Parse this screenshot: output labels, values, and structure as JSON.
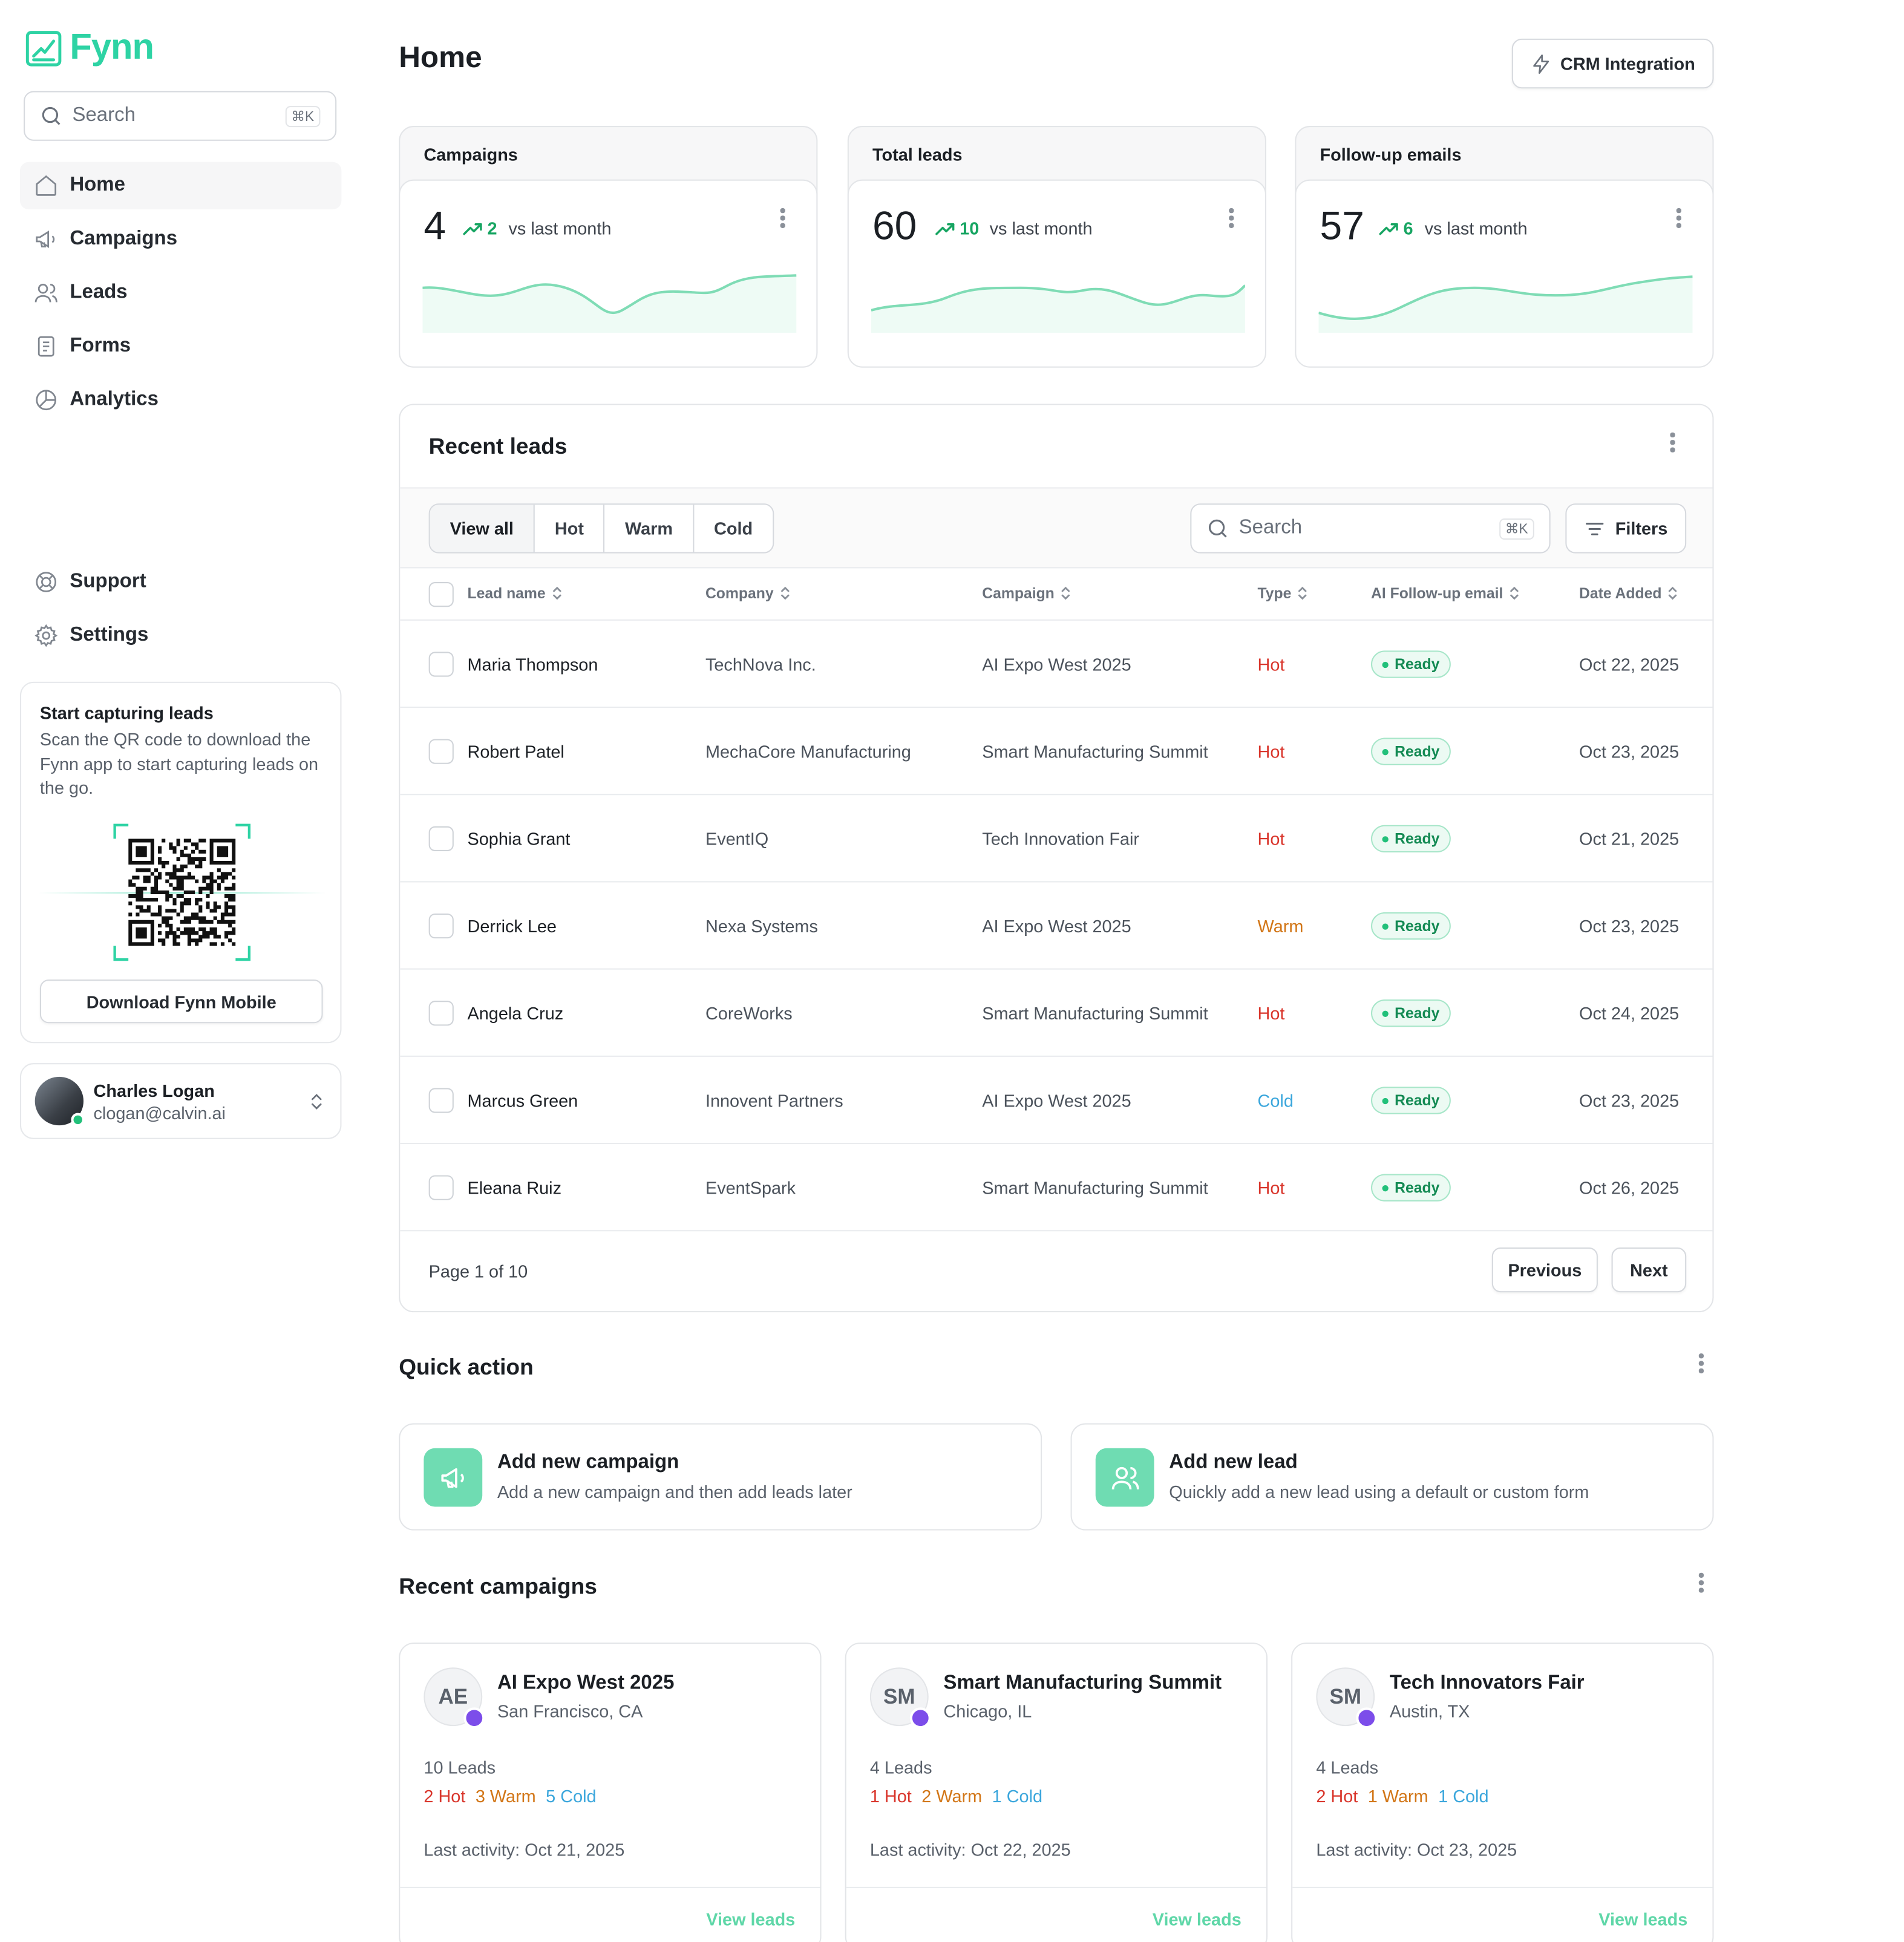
{
  "app": {
    "brand": "Fynn",
    "accent": "#2ed3a4"
  },
  "sidebar": {
    "search": {
      "placeholder": "Search",
      "shortcut": "⌘K"
    },
    "items": [
      {
        "label": "Home",
        "icon": "home-icon",
        "active": true
      },
      {
        "label": "Campaigns",
        "icon": "megaphone-icon"
      },
      {
        "label": "Leads",
        "icon": "users-icon"
      },
      {
        "label": "Forms",
        "icon": "form-icon"
      },
      {
        "label": "Analytics",
        "icon": "pie-chart-icon"
      }
    ],
    "bottom_items": [
      {
        "label": "Support",
        "icon": "lifebuoy-icon"
      },
      {
        "label": "Settings",
        "icon": "gear-icon"
      }
    ],
    "promo": {
      "title": "Start capturing leads",
      "text": "Scan the QR code to download the Fynn app to start capturing leads on the go.",
      "button": "Download Fynn Mobile"
    },
    "user": {
      "name": "Charles Logan",
      "email": "clogan@calvin.ai",
      "online": true
    }
  },
  "header": {
    "title": "Home",
    "crm_button": "CRM Integration"
  },
  "stats": [
    {
      "title": "Campaigns",
      "value": "4",
      "delta": "2",
      "vs": "vs last month"
    },
    {
      "title": "Total leads",
      "value": "60",
      "delta": "10",
      "vs": "vs last month"
    },
    {
      "title": "Follow-up emails",
      "value": "57",
      "delta": "6",
      "vs": "vs last month"
    }
  ],
  "recent_leads": {
    "title": "Recent leads",
    "filters": [
      "View all",
      "Hot",
      "Warm",
      "Cold"
    ],
    "active_filter": "View all",
    "search": {
      "placeholder": "Search",
      "shortcut": "⌘K"
    },
    "filters_button": "Filters",
    "columns": [
      "Lead name",
      "Company",
      "Campaign",
      "Type",
      "AI Follow-up email",
      "Date Added"
    ],
    "rows": [
      {
        "name": "Maria Thompson",
        "company": "TechNova Inc.",
        "campaign": "AI Expo West 2025",
        "type": "Hot",
        "email": "Ready",
        "date": "Oct 22, 2025"
      },
      {
        "name": "Robert Patel",
        "company": "MechaCore Manufacturing",
        "campaign": "Smart Manufacturing Summit",
        "type": "Hot",
        "email": "Ready",
        "date": "Oct 23, 2025"
      },
      {
        "name": "Sophia Grant",
        "company": "EventIQ",
        "campaign": "Tech Innovation Fair",
        "type": "Hot",
        "email": "Ready",
        "date": "Oct 21, 2025"
      },
      {
        "name": "Derrick Lee",
        "company": "Nexa Systems",
        "campaign": "AI Expo West 2025",
        "type": "Warm",
        "email": "Ready",
        "date": "Oct 23, 2025"
      },
      {
        "name": "Angela Cruz",
        "company": "CoreWorks",
        "campaign": "Smart Manufacturing Summit",
        "type": "Hot",
        "email": "Ready",
        "date": "Oct 24, 2025"
      },
      {
        "name": "Marcus Green",
        "company": "Innovent Partners",
        "campaign": "AI Expo West 2025",
        "type": "Cold",
        "email": "Ready",
        "date": "Oct 23, 2025"
      },
      {
        "name": "Eleana Ruiz",
        "company": "EventSpark",
        "campaign": "Smart Manufacturing Summit",
        "type": "Hot",
        "email": "Ready",
        "date": "Oct 26, 2025"
      }
    ],
    "pager": {
      "text": "Page 1 of 10",
      "previous": "Previous",
      "next": "Next"
    }
  },
  "quick_action": {
    "title": "Quick action",
    "items": [
      {
        "title": "Add new campaign",
        "desc": "Add a new campaign and then add leads later",
        "icon": "megaphone-icon"
      },
      {
        "title": "Add new lead",
        "desc": "Quickly add a new lead using a default or custom form",
        "icon": "users-icon"
      }
    ]
  },
  "recent_campaigns": {
    "title": "Recent campaigns",
    "items": [
      {
        "initials": "AE",
        "name": "AI Expo West 2025",
        "location": "San Francisco, CA",
        "leads": "10 Leads",
        "hot": "2 Hot",
        "warm": "3 Warm",
        "cold": "5 Cold",
        "last": "Last activity: Oct 21, 2025",
        "link": "View leads"
      },
      {
        "initials": "SM",
        "name": "Smart Manufacturing Summit",
        "location": "Chicago, IL",
        "leads": "4 Leads",
        "hot": "1 Hot",
        "warm": "2 Warm",
        "cold": "1 Cold",
        "last": "Last activity: Oct 22, 2025",
        "link": "View leads"
      },
      {
        "initials": "SM",
        "name": "Tech Innovators Fair",
        "location": "Austin, TX",
        "leads": "4 Leads",
        "hot": "2 Hot",
        "warm": "1 Warm",
        "cold": "1 Cold",
        "last": "Last activity: Oct 23, 2025",
        "link": "View leads"
      }
    ]
  },
  "colors": {
    "hot": "#d9352b",
    "warm": "#d27617",
    "cold": "#3aa6dc",
    "ready": "#138a53",
    "positive": "#17a562"
  }
}
